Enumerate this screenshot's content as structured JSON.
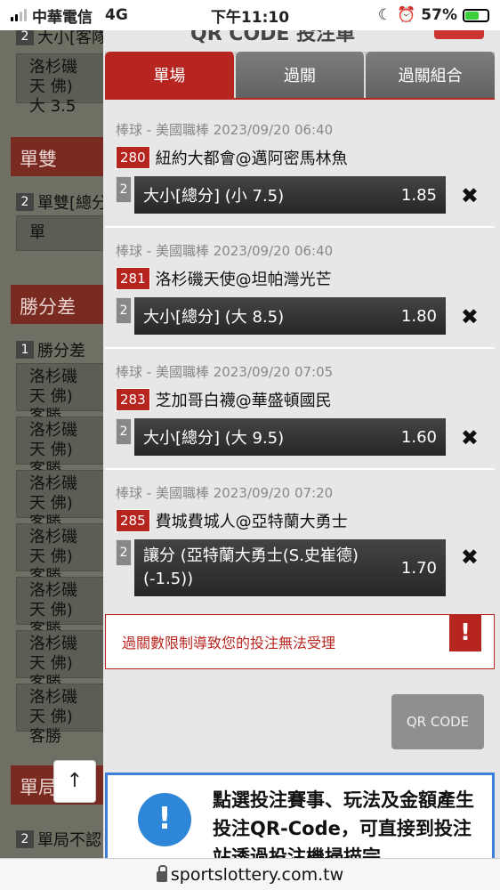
{
  "status_bar": {
    "carrier": "中華電信",
    "network": "4G",
    "time": "下午11:10",
    "battery": "57%"
  },
  "background_page": {
    "top_label": "大小[客隊",
    "top_label_num": "2",
    "top_cell": "洛杉磯天 佛) 大 3.5",
    "section_1": "單雙",
    "row_1_num": "2",
    "row_1_label": "單雙[總分",
    "row_1_cell": "單",
    "section_2": "勝分差",
    "row_2_num": "1",
    "row_2_label": "勝分差",
    "cells": [
      "洛杉磯天 佛) 客勝",
      "洛杉磯天 佛) 客勝",
      "洛杉磯天 佛) 客勝",
      "洛杉磯天 佛) 客勝",
      "洛杉磯天 佛) 客勝",
      "洛杉磯天 佛) 客勝",
      "洛杉磯天 佛) 客勝"
    ],
    "section_3": "單局",
    "row_3_num": "2",
    "row_3_label": "單局不認",
    "up_arrow": "↑"
  },
  "modal": {
    "title": "QR CODE 投注單",
    "tabs": [
      {
        "label": "單場",
        "active": true
      },
      {
        "label": "過關",
        "active": false
      },
      {
        "label": "過關組合",
        "active": false
      }
    ],
    "bets": [
      {
        "meta": "棒球 - 美國職棒 2023/09/20 06:40",
        "code": "280",
        "match": "紐約大都會@邁阿密馬林魚",
        "index": "2",
        "pick": "大小[總分] (小 7.5)",
        "odds": "1.85"
      },
      {
        "meta": "棒球 - 美國職棒 2023/09/20 06:40",
        "code": "281",
        "match": "洛杉磯天使@坦帕灣光芒",
        "index": "2",
        "pick": "大小[總分] (大 8.5)",
        "odds": "1.80"
      },
      {
        "meta": "棒球 - 美國職棒 2023/09/20 07:05",
        "code": "283",
        "match": "芝加哥白襪@華盛頓國民",
        "index": "2",
        "pick": "大小[總分] (大 9.5)",
        "odds": "1.60"
      },
      {
        "meta": "棒球 - 美國職棒 2023/09/20 07:20",
        "code": "285",
        "match": "費城費城人@亞特蘭大勇士",
        "index": "2",
        "pick": "讓分 (亞特蘭大勇士(S.史崔德) (-1.5))",
        "odds": "1.70"
      }
    ],
    "delete_glyph": "✖",
    "error_text": "過關數限制導致您的投注無法受理",
    "error_icon": "!",
    "qr_button": "QR CODE",
    "info_icon": "!",
    "info_text": "點選投注賽事、玩法及金額產生投注QR-Code，可直接到投注站透過投注機掃描完"
  },
  "url_bar": {
    "url": "sportslottery.com.tw"
  }
}
